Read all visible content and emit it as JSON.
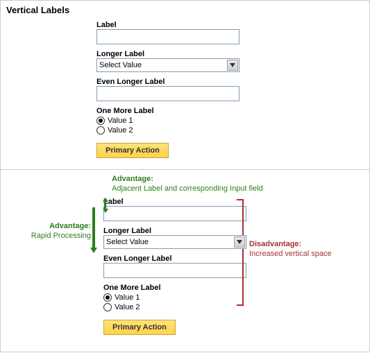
{
  "title": "Vertical Labels",
  "form": {
    "label1": "Label",
    "input1_value": "",
    "label2": "Longer Label",
    "select_value": "Select Value",
    "label3": "Even Longer Label",
    "input3_value": "",
    "label4": "One More Label",
    "radio1_label": "Value 1",
    "radio2_label": "Value 2",
    "radio_selected": "value1",
    "button_label": "Primary Action"
  },
  "annotations": {
    "advantage1_title": "Advantage:",
    "advantage1_text": "Adjacent Label and corresponding Input field",
    "advantage2_title": "Advantage:",
    "advantage2_text": "Rapid Processing",
    "disadvantage_title": "Disadvantage:",
    "disadvantage_text": "Increased vertical space"
  }
}
